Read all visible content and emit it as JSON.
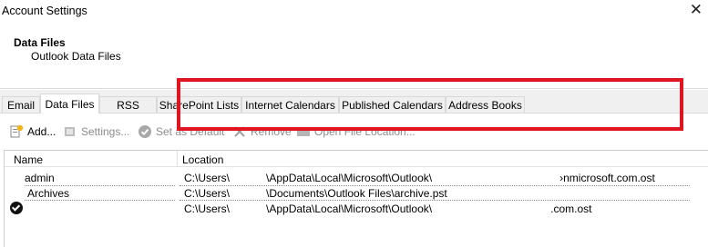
{
  "window": {
    "title": "Account Settings",
    "close_glyph": "✕"
  },
  "header": {
    "title": "Data Files",
    "subtitle": "Outlook Data Files"
  },
  "tabs": [
    {
      "label": "Email"
    },
    {
      "label": "Data Files",
      "active": true
    },
    {
      "label": "RSS Feeds"
    },
    {
      "label": "SharePoint Lists"
    },
    {
      "label": "Internet Calendars"
    },
    {
      "label": "Published Calendars"
    },
    {
      "label": "Address Books"
    }
  ],
  "toolbar": {
    "add": "Add...",
    "settings": "Settings...",
    "set_default": "Set as Default",
    "remove": "Remove",
    "open_location": "Open File Location..."
  },
  "table": {
    "columns": [
      "Name",
      "Location"
    ],
    "rows": [
      {
        "name": "admin",
        "location": "C:\\Users\\            \\AppData\\Local\\Microsoft\\Outlook\\                                          ›nmicrosoft.com.ost",
        "default": false
      },
      {
        "name": "Archives",
        "location": "C:\\Users\\            \\Documents\\Outlook Files\\archive.pst",
        "default": false
      },
      {
        "name": "",
        "location": "C:\\Users\\            \\AppData\\Local\\Microsoft\\Outlook\\                                       .com.ost",
        "default": true
      }
    ]
  },
  "colors": {
    "highlight": "#e0141e",
    "disabled_text": "#8c8c8c"
  }
}
